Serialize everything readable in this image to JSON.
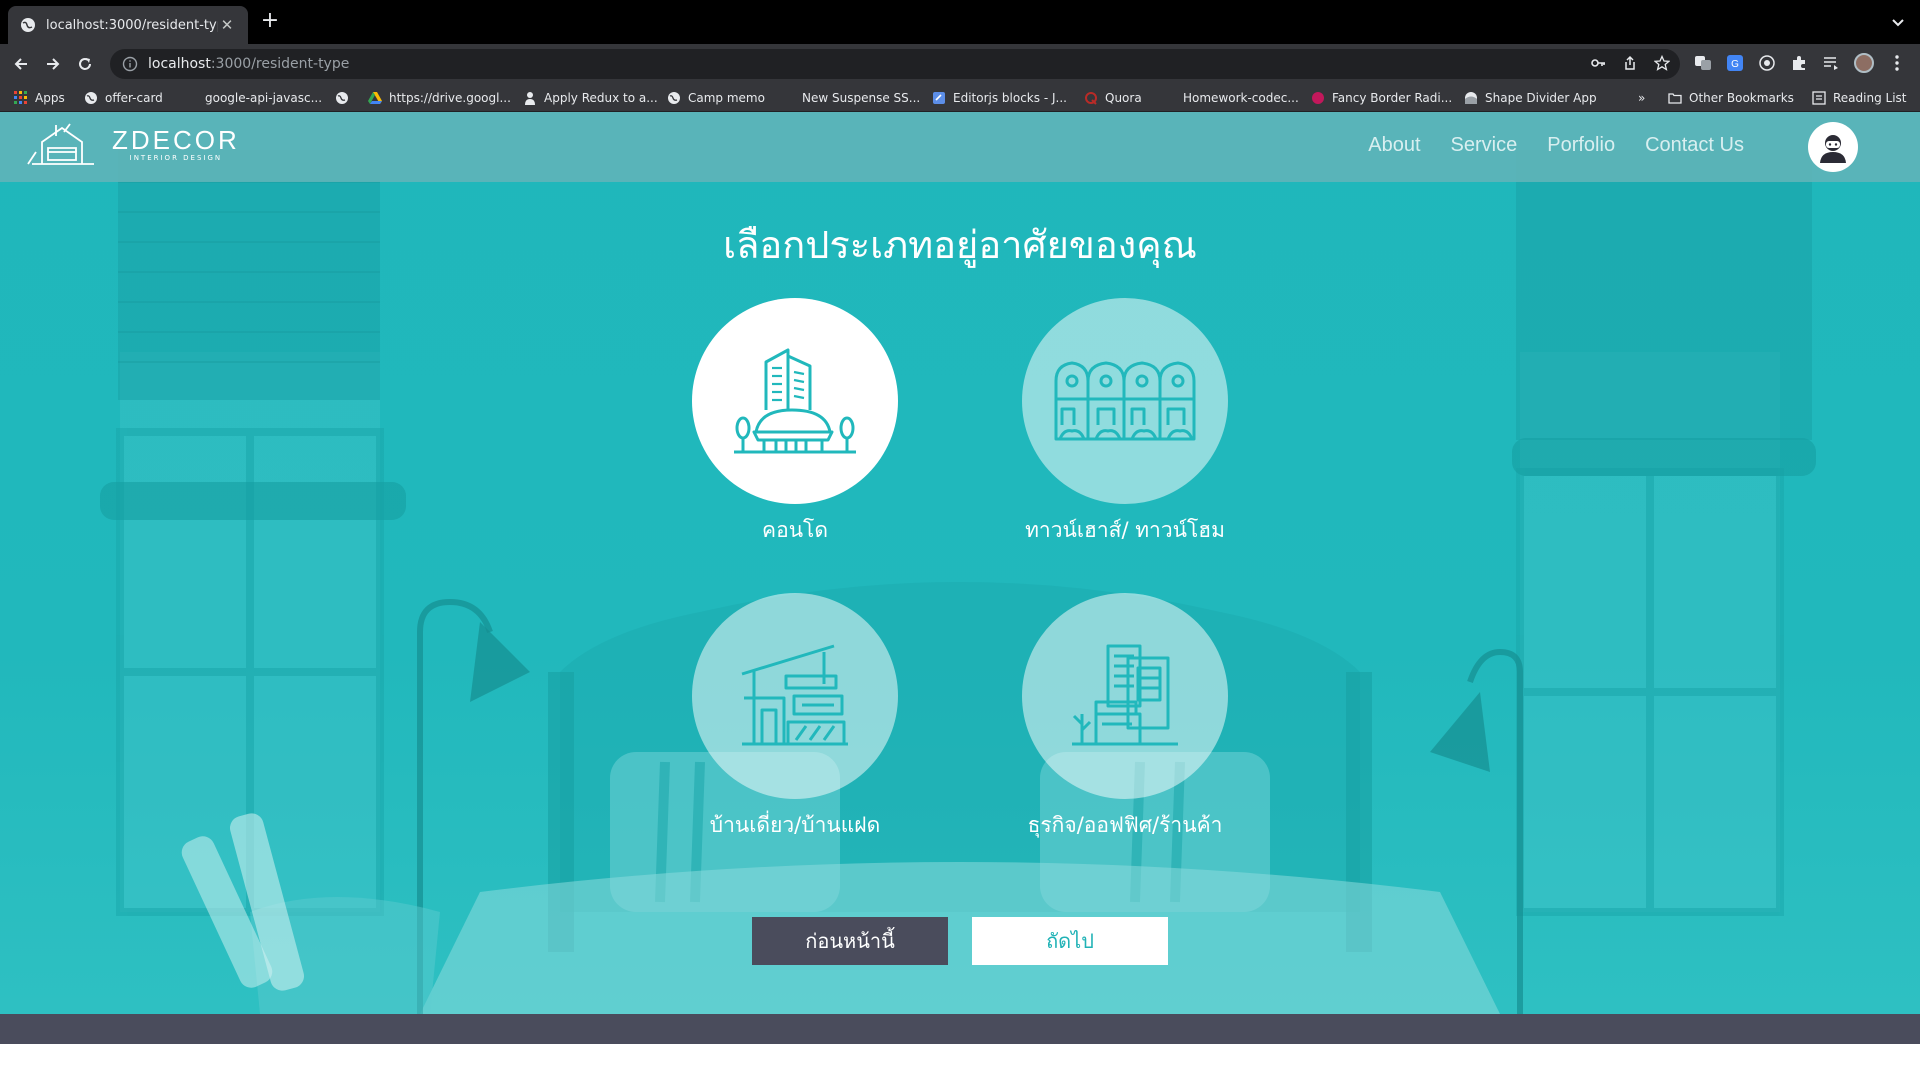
{
  "browser": {
    "tab_title": "localhost:3000/resident-type",
    "url_host": "localhost",
    "url_path": ":3000/resident-type",
    "bookmarks": [
      {
        "label": "Apps",
        "icon": "apps-grid-icon"
      },
      {
        "label": "offer-card",
        "icon": "globe-icon"
      },
      {
        "label": "google-api-javasc...",
        "icon": "blank-icon"
      },
      {
        "label": "",
        "icon": "globe-icon"
      },
      {
        "label": "https://drive.googl...",
        "icon": "drive-icon"
      },
      {
        "label": "Apply Redux to a...",
        "icon": "person-icon"
      },
      {
        "label": "Camp memo",
        "icon": "globe-icon"
      },
      {
        "label": "New Suspense SS...",
        "icon": "blank-icon"
      },
      {
        "label": "Editorjs blocks - J...",
        "icon": "editor-icon"
      },
      {
        "label": "Quora",
        "icon": "quora-icon"
      },
      {
        "label": "Homework-codec...",
        "icon": "blank-icon"
      },
      {
        "label": "Fancy Border Radi...",
        "icon": "pink-dot-icon"
      },
      {
        "label": "Shape Divider App",
        "icon": "shape-icon"
      }
    ],
    "more_bookmarks": "»",
    "other_bookmarks": "Other Bookmarks",
    "reading_list": "Reading List"
  },
  "site": {
    "logo_main": "ZDECOR",
    "logo_sub": "INTERIOR DESIGN",
    "menu": [
      "About",
      "Service",
      "Porfolio",
      "Contact Us"
    ],
    "accent": "#21b8bc",
    "dark": "#4a4c5c"
  },
  "main": {
    "title": "เลือกประเภทอยู่อาศัยของคุณ",
    "options": [
      {
        "label": "คอนโด",
        "icon": "condo-building-icon",
        "selected": true
      },
      {
        "label": "ทาวน์เฮาส์/ ทาวน์โฮม",
        "icon": "townhouse-icon",
        "selected": false
      },
      {
        "label": "บ้านเดี่ยว/บ้านแฝด",
        "icon": "house-icon",
        "selected": false
      },
      {
        "label": "ธุรกิจ/ออฟฟิศ/ร้านค้า",
        "icon": "office-icon",
        "selected": false
      }
    ],
    "prev_label": "ก่อนหน้านี้",
    "next_label": "ถัดไป"
  }
}
